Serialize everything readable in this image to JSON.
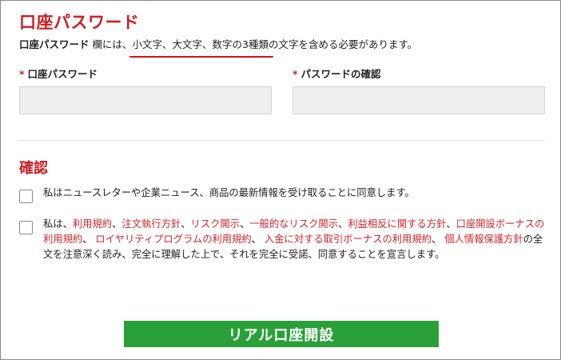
{
  "section1": {
    "title": "口座パスワード",
    "hint": {
      "bold": "口座パスワード",
      "pre": " 欄には、",
      "underlined": "小文字、大文字、数字の3種類",
      "post": "の文字を含める必要があります。"
    },
    "password_field": {
      "required_mark": "*",
      "label": "口座パスワード",
      "value": ""
    },
    "confirm_field": {
      "required_mark": "*",
      "label": "パスワードの確認",
      "value": ""
    }
  },
  "section2": {
    "title": "確認",
    "newsletter_checkbox": {
      "checked": false,
      "text": "私はニュースレターや企業ニュース、商品の最新情報を受け取ることに同意します。"
    },
    "terms_checkbox": {
      "checked": false,
      "prefix": "私は、",
      "links": [
        "利用規約",
        "注文執行方針",
        "リスク開示",
        "一般的なリスク開示",
        "利益相反に関する方針",
        "口座開設ボーナスの利用規約",
        "ロイヤリティプログラムの利用規約",
        "入金に対する取引ボーナスの利用規約",
        "個人情報保護方針"
      ],
      "separator": "、",
      "suffix": "の全文を注意深く読み、完全に理解した上で、それを完全に受諾、同意することを宣言します。"
    }
  },
  "submit_button": {
    "label": "リアル口座開設"
  },
  "colors": {
    "accent_red": "#cc1f24",
    "link_red": "#d0262b",
    "button_green": "#2aa138",
    "field_bg": "#efefef"
  }
}
